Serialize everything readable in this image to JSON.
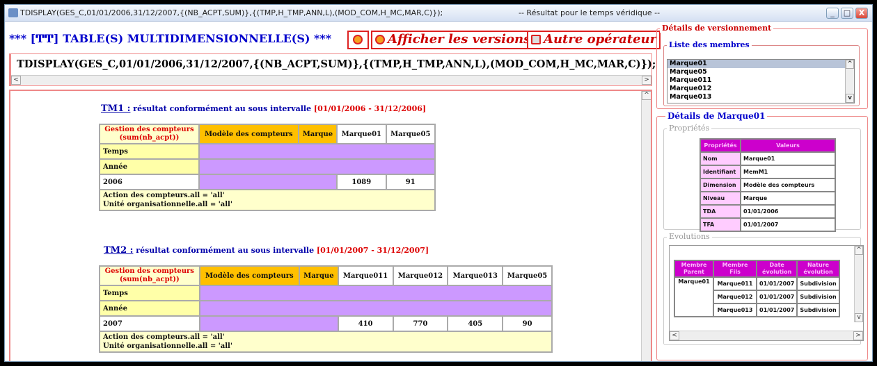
{
  "window": {
    "title": "TDISPLAY(GES_C,01/01/2006,31/12/2007,{(NB_ACPT,SUM)},{(TMP,H_TMP,ANN,L),(MOD_COM,H_MC,MAR,C)});",
    "subtitle": "-- Résultat pour le temps véridique --",
    "minimize": "_",
    "maximize": "□",
    "close": "X"
  },
  "toolbar": {
    "title": "*** [ͲͲ] TABLE(S) MULTIDIMENSIONNELLE(S) ***",
    "show_versions_label": "Afficher les versions",
    "other_operator_label": "Autre opérateur"
  },
  "command": {
    "text": "TDISPLAY(GES_C,01/01/2006,31/12/2007,{(NB_ACPT,SUM)},{(TMP,H_TMP,ANN,L),(MOD_COM,H_MC,MAR,C)});"
  },
  "scroll": {
    "left": "<",
    "right": ">",
    "up": "^",
    "down": "v"
  },
  "results": [
    {
      "tm": "TM1 :",
      "caption": "résultat conformément au sous intervalle",
      "range": "[01/01/2006 - 31/12/2006]",
      "measure_header": "Gestion des compteurs (sum(nb_acpt))",
      "dim_header": "Modèle des compteurs",
      "level_header": "Marque",
      "members": [
        "Marque01",
        "Marque05"
      ],
      "row_time": "Temps",
      "row_year": "Année",
      "year": "2006",
      "values": [
        "1089",
        "91"
      ],
      "footer_line1": "Action des compteurs.all = 'all'",
      "footer_line2": "Unité organisationnelle.all = 'all'"
    },
    {
      "tm": "TM2 :",
      "caption": "résultat conformément au sous intervalle",
      "range": "[01/01/2007 - 31/12/2007]",
      "measure_header": "Gestion des compteurs (sum(nb_acpt))",
      "dim_header": "Modèle des compteurs",
      "level_header": "Marque",
      "members": [
        "Marque011",
        "Marque012",
        "Marque013",
        "Marque05"
      ],
      "row_time": "Temps",
      "row_year": "Année",
      "year": "2007",
      "values": [
        "410",
        "770",
        "405",
        "90"
      ],
      "footer_line1": "Action des compteurs.all = 'all'",
      "footer_line2": "Unité organisationnelle.all = 'all'"
    }
  ],
  "versioning": {
    "title": "Détails de versionnement",
    "members_title": "Liste des membres",
    "members": [
      "Marque01",
      "Marque05",
      "Marque011",
      "Marque012",
      "Marque013"
    ],
    "details_title": "Détails de Marque01",
    "properties_title": "Propriétés",
    "prop_header_key": "Propriétés",
    "prop_header_value": "Valeurs",
    "properties": [
      {
        "key": "Nom",
        "value": "Marque01"
      },
      {
        "key": "Identifiant",
        "value": "MemM1"
      },
      {
        "key": "Dimension",
        "value": "Modèle des compteurs"
      },
      {
        "key": "Niveau",
        "value": "Marque"
      },
      {
        "key": "TDA",
        "value": "01/01/2006"
      },
      {
        "key": "TFA",
        "value": "01/01/2007"
      }
    ],
    "evolutions_title": "Evolutions",
    "evo_headers": [
      "Membre Parent",
      "Membre Fils",
      "Date évolution",
      "Nature évolution"
    ],
    "evo_parent": "Marque01",
    "evolutions": [
      {
        "child": "Marque011",
        "date": "01/01/2007",
        "nature": "Subdivision"
      },
      {
        "child": "Marque012",
        "date": "01/01/2007",
        "nature": "Subdivision"
      },
      {
        "child": "Marque013",
        "date": "01/01/2007",
        "nature": "Subdivision"
      }
    ]
  },
  "colors": {
    "accent_red": "#cc0000",
    "accent_blue": "#0000cc",
    "header_orange": "#ffc000",
    "cell_purple": "#cc99ff",
    "prop_magenta": "#cc00cc"
  }
}
